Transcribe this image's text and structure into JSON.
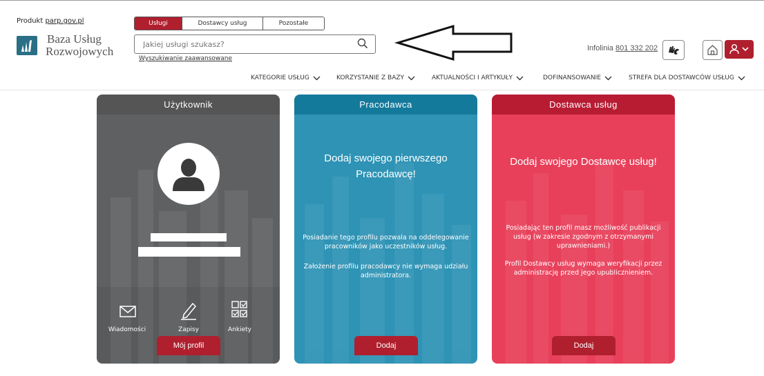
{
  "header": {
    "produkt_prefix": "Produkt",
    "produkt_link": "parp.gov.pl",
    "logo_line1": "Baza Usług",
    "logo_line2": "Rozwojowych",
    "tabs": [
      {
        "label": "Usługi",
        "active": true
      },
      {
        "label": "Dostawcy usług",
        "active": false
      },
      {
        "label": "Pozostałe",
        "active": false
      }
    ],
    "search_placeholder": "Jakiej usługi szukasz?",
    "advanced_search": "Wyszukiwanie zaawansowane",
    "infolinia_label": "Infolinia",
    "infolinia_number": "801 332 202"
  },
  "nav": [
    {
      "label": "KATEGORIE USŁUG"
    },
    {
      "label": "KORZYSTANIE Z BAZY"
    },
    {
      "label": "AKTUALNOŚCI I ARTYKUŁY"
    },
    {
      "label": "DOFINANSOWANIE"
    },
    {
      "label": "STREFA DLA DOSTAWCÓW USŁUG"
    }
  ],
  "cards": {
    "user": {
      "header": "Użytkownik",
      "actions": [
        {
          "label": "Wiadomości",
          "icon": "envelope-icon"
        },
        {
          "label": "Zapisy",
          "icon": "pencil-icon"
        },
        {
          "label": "Ankiety",
          "icon": "checklist-icon"
        }
      ],
      "button": "Mój profil",
      "color": "#58595b"
    },
    "employer": {
      "header": "Pracodawca",
      "title": "Dodaj swojego pierwszego Pracodawcę!",
      "description1": "Posiadanie tego profilu pozwala na oddelegowanie pracowników jako uczestników usług.",
      "description2": "Założenie profilu pracodawcy nie wymaga udziału administratora.",
      "button": "Dodaj",
      "color": "#2e93b5"
    },
    "provider": {
      "header": "Dostawca usług",
      "title": "Dodaj swojego Dostawcę usług!",
      "description1": "Posiadając ten profil masz możliwość publikacji usług (w zakresie zgodnym z otrzymanymi uprawnieniami.)",
      "description2": "Profil Dostawcy usług wymaga weryfikacji przez administrację przed jego upublicznieniem.",
      "button": "Dodaj",
      "color": "#e8405a"
    }
  },
  "colors": {
    "brand_red": "#b01f2e",
    "header_gray": "#555555",
    "header_teal": "#147a9b",
    "header_red": "#b81c33"
  }
}
